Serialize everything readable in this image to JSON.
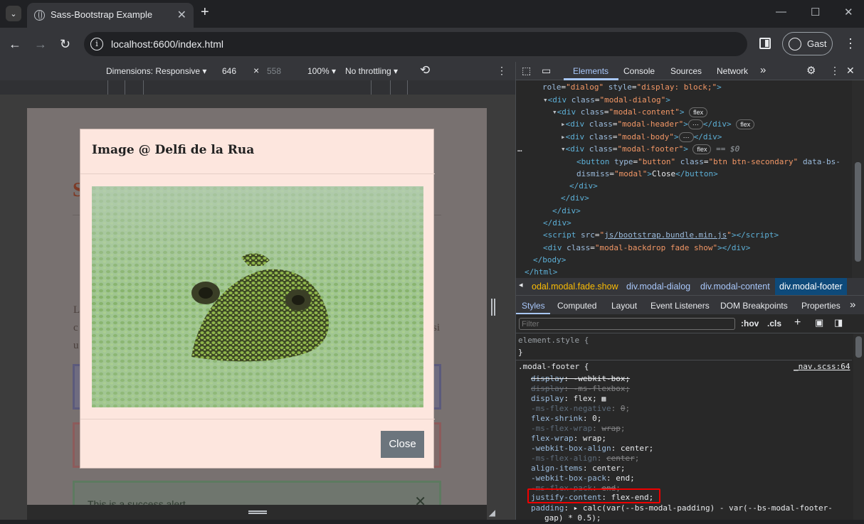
{
  "browser": {
    "tab_title": "Sass-Bootstrap Example",
    "tab_close": "✕",
    "new_tab": "+",
    "url": "localhost:6600/index.html",
    "profile_label": "Gast",
    "window_controls": {
      "minimize": "—",
      "maximize": "☐",
      "close": "✕"
    }
  },
  "device_toolbar": {
    "dimensions_label": "Dimensions: Responsive ▾",
    "width": "646",
    "separator": "×",
    "height": "558",
    "zoom": "100% ▾",
    "throttling": "No throttling ▾",
    "more": "⋮"
  },
  "page": {
    "heading_fragment": "S",
    "para_fragment_1": "L",
    "para_fragment_2": "c",
    "para_fragment_3": "u",
    "para_fragment_right": "si",
    "alert_text": "This is a success alert",
    "modal_title": "Image @ Delfi de la Rua",
    "close_button": "Close"
  },
  "devtools": {
    "tabs": [
      "Elements",
      "Console",
      "Sources",
      "Network"
    ],
    "active_tab": "Elements",
    "more_tabs": "»",
    "breadcrumbs": [
      "odal.modal.fade.show",
      "div.modal-dialog",
      "div.modal-content",
      "div.modal-footer"
    ],
    "styles_tabs": [
      "Styles",
      "Computed",
      "Layout",
      "Event Listeners",
      "DOM Breakpoints",
      "Properties"
    ],
    "filter_placeholder": "Filter",
    "hov": ":hov",
    "cls": ".cls",
    "element_style": "element.style {",
    "close_brace": "}",
    "rule_selector": ".modal-footer {",
    "rule_source": "_nav.scss:64",
    "flex_pill": "flex",
    "eq_sel": "== $0",
    "ellipsis": "⋯",
    "dots": "…"
  },
  "colors": {
    "modal_bg": "#fde6de",
    "close_button_bg": "#6c757d",
    "devtools_accent": "#a8c7fa",
    "highlight_box": "#ee0000"
  }
}
